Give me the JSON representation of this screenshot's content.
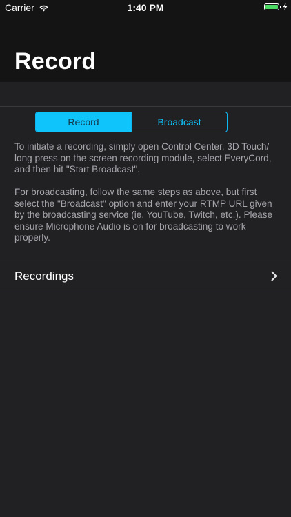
{
  "status_bar": {
    "carrier": "Carrier",
    "time": "1:40 PM",
    "battery_level": 1.0,
    "wifi_icon": "wifi-icon",
    "battery_icon": "battery-icon",
    "charging_icon": "bolt-icon"
  },
  "header": {
    "title": "Record"
  },
  "segmented_control": {
    "options": [
      "Record",
      "Broadcast"
    ],
    "selected": "Record"
  },
  "instructions": {
    "paragraph_1": "To initiate a recording, simply open Control Center, 3D Touch/ long press on the screen recording module, select EveryCord, and then hit \"Start Broadcast\".",
    "paragraph_2": "For broadcasting, follow the same steps as above, but first select the \"Broadcast\" option and enter your RTMP URL given by the broadcasting service (ie. YouTube, Twitch, etc.). Please ensure Microphone Audio is on for broadcasting to work properly."
  },
  "recordings_row": {
    "label": "Recordings",
    "icon": "chevron-right-icon"
  },
  "colors": {
    "background": "#212124",
    "header_background": "#141415",
    "accent": "#0fc3fb",
    "body_text": "#a5a5aa",
    "divider": "#3a3a3e",
    "battery": "#4cd964"
  }
}
